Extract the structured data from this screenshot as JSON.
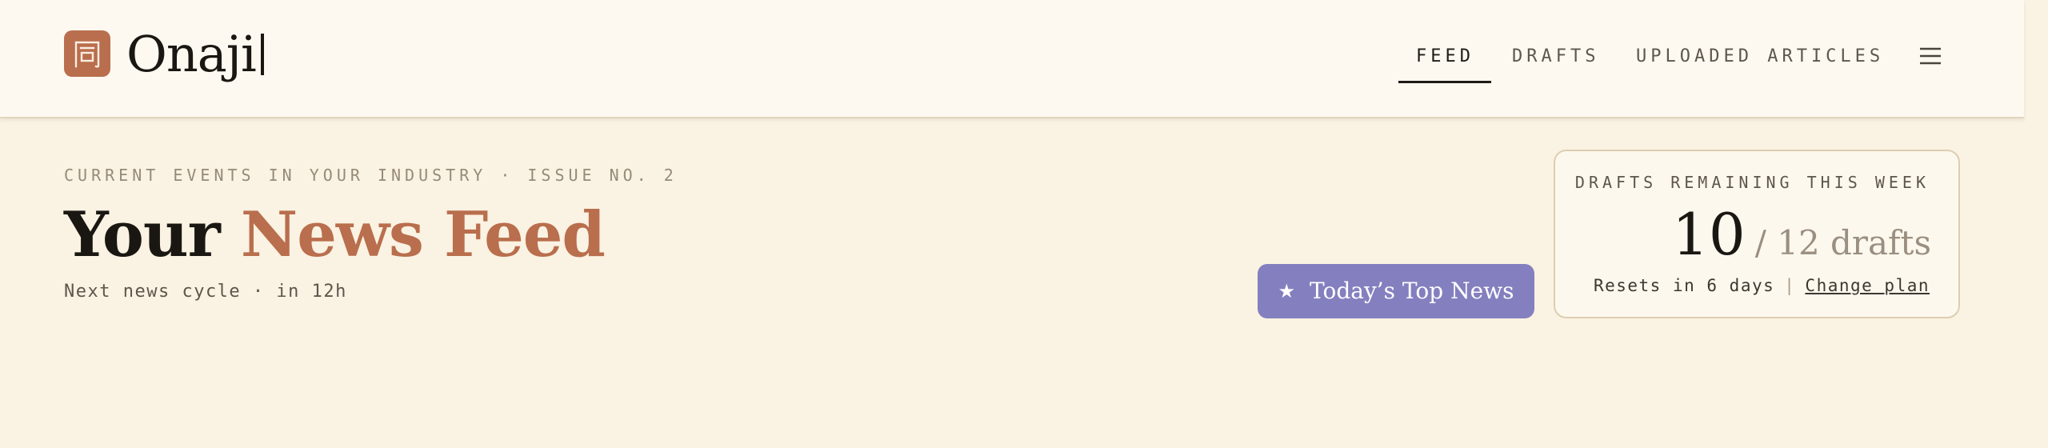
{
  "brand": {
    "name": "Onaji",
    "logo_glyph": "同",
    "accent_color": "#b96e4d"
  },
  "nav": {
    "items": [
      {
        "label": "FEED",
        "active": true
      },
      {
        "label": "DRAFTS",
        "active": false
      },
      {
        "label": "UPLOADED ARTICLES",
        "active": false
      }
    ],
    "menu_icon": "hamburger-menu-icon"
  },
  "header": {
    "eyebrow": "CURRENT EVENTS IN YOUR INDUSTRY · ISSUE NO. 2",
    "title_plain": "Your",
    "title_accent": "News Feed",
    "subline": "Next news cycle · in 12h"
  },
  "top_news_button": {
    "icon": "star-icon",
    "star": "★",
    "label": "Today’s Top News",
    "color": "#8480bf"
  },
  "drafts": {
    "caption": "DRAFTS REMAINING THIS WEEK",
    "remaining": "10",
    "total_text": "/ 12 drafts",
    "reset_text": "Resets in 6 days",
    "separator": "|",
    "change_plan": "Change plan"
  }
}
